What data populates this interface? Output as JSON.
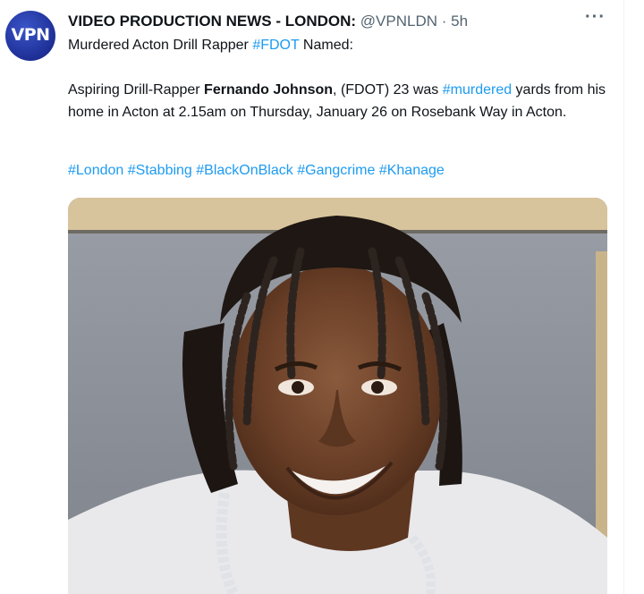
{
  "tweet": {
    "display_name": "VIDEO PRODUCTION NEWS - LONDON:",
    "handle": "@VPNLDN",
    "separator": "·",
    "time": "5h",
    "more_label": "···",
    "avatar_text": "VPN",
    "line1_text": "Murdered Acton Drill Rapper ",
    "line1_hashtag": "#FDOT",
    "line1_suffix": " Named:",
    "body": {
      "part1": "Aspiring Drill-Rapper ",
      "bold_name": "Fernando Johnson",
      "part2": ", (FDOT) 23 was ",
      "hashtag": "#murdered",
      "part3": " yards from his home in Acton at 2.15am on  Thursday, January 26 on Rosebank Way in Acton."
    },
    "hashtags": [
      "#London",
      "#Stabbing",
      "#BlackOnBlack",
      "#Gangcrime",
      "#Khanage"
    ]
  },
  "colors": {
    "link": "#1d9bf0",
    "text": "#0f1419",
    "muted": "#536471",
    "avatar": "#1e2f96"
  },
  "icons": {
    "more": "more-horizontal-icon"
  }
}
